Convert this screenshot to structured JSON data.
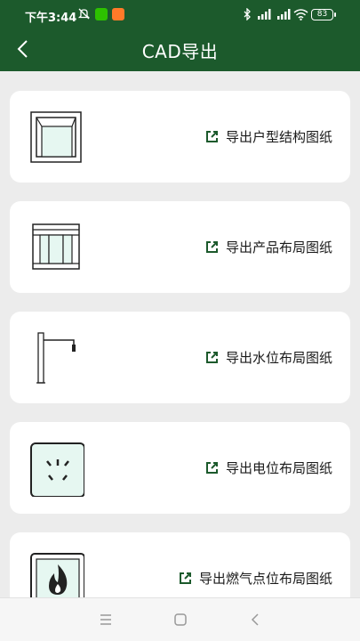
{
  "status_bar": {
    "time": "下午3:44",
    "battery": "83"
  },
  "header": {
    "title": "CAD导出"
  },
  "cards": [
    {
      "label": "导出户型结构图纸",
      "icon": "floorplan-structure-icon"
    },
    {
      "label": "导出产品布局图纸",
      "icon": "cabinet-layout-icon"
    },
    {
      "label": "导出水位布局图纸",
      "icon": "faucet-icon"
    },
    {
      "label": "导出电位布局图纸",
      "icon": "power-socket-icon"
    },
    {
      "label": "导出燃气点位布局图纸",
      "icon": "gas-flame-icon"
    }
  ],
  "colors": {
    "header_bg": "#1c5a2c",
    "accent": "#1c5a2c",
    "page_bg": "#ececec"
  }
}
